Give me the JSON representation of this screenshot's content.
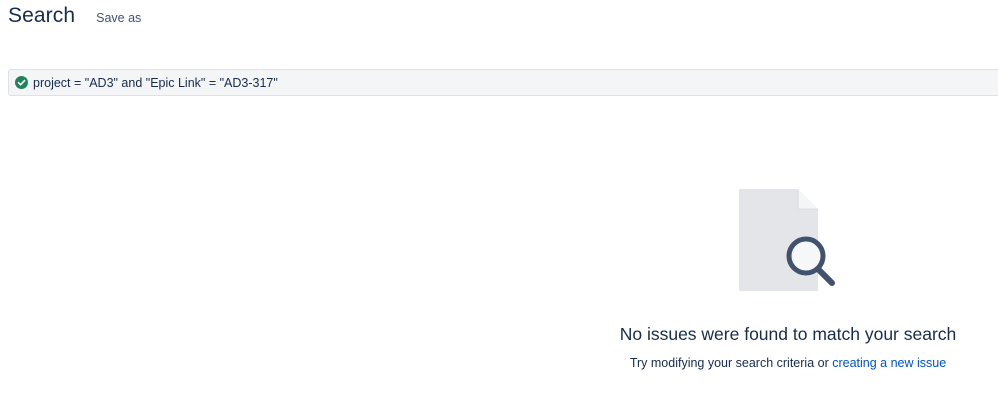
{
  "header": {
    "title": "Search",
    "save_as_label": "Save as"
  },
  "search": {
    "query": "project = \"AD3\" and \"Epic Link\" = \"AD3-317\"",
    "status_icon": "check-circle-icon",
    "status_color": "#1f845a"
  },
  "empty_state": {
    "illustration": "document-magnifier-illustration",
    "title": "No issues were found to match your search",
    "hint_text": "Try modifying your search criteria or ",
    "link_text": "creating a new issue",
    "link_color": "#0052cc"
  }
}
